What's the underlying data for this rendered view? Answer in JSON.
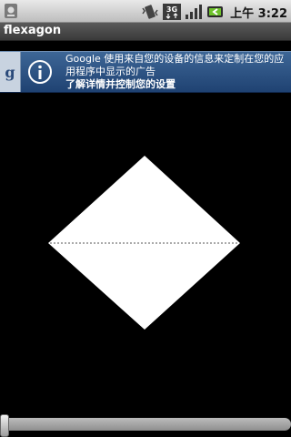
{
  "status_bar": {
    "time": "上午 3:22",
    "icons": [
      "device-icon",
      "vibrate-icon",
      "3g-icon",
      "signal-icon",
      "battery-icon"
    ]
  },
  "title_bar": {
    "title": "flexagon"
  },
  "ad_banner": {
    "logo_letter": "g",
    "icon": "info-icon",
    "line1": "Google  使用来自您的设备的信息来定制在您的应用程序中显示的广告",
    "line2": "了解详情并控制您的设置"
  },
  "canvas": {
    "shape": "diamond",
    "fill": "#ffffff",
    "fold_line": "dotted-horizontal"
  },
  "slider": {
    "value": 0.0
  }
}
